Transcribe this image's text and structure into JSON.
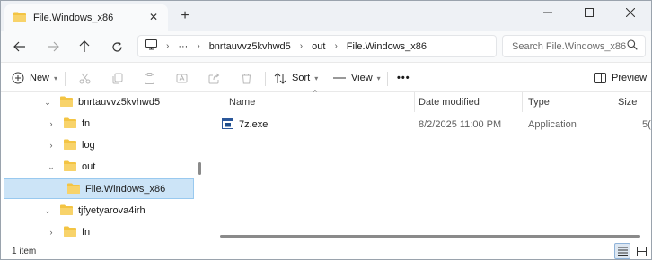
{
  "window": {
    "tab_title": "File.Windows_x86",
    "new_tab_symbol": "+",
    "close_tab_symbol": "✕"
  },
  "address": {
    "ellipsis": "···",
    "crumbs": [
      "bnrtauvvz5kvhwd5",
      "out",
      "File.Windows_x86"
    ],
    "search_placeholder": "Search File.Windows_x86"
  },
  "toolbar": {
    "new_label": "New",
    "sort_label": "Sort",
    "view_label": "View",
    "more_label": "•••",
    "preview_label": "Preview"
  },
  "nav_tree": [
    {
      "label": "bnrtauvvz5kvhwd5",
      "expanded": true,
      "selected": false
    },
    {
      "label": "fn",
      "expanded": false,
      "selected": false
    },
    {
      "label": "log",
      "expanded": false,
      "selected": false
    },
    {
      "label": "out",
      "expanded": true,
      "selected": false
    },
    {
      "label": "File.Windows_x86",
      "expanded": false,
      "selected": true
    },
    {
      "label": "tjfyetyarova4irh",
      "expanded": true,
      "selected": false
    },
    {
      "label": "fn",
      "expanded": false,
      "selected": false
    }
  ],
  "columns": {
    "name": "Name",
    "date_modified": "Date modified",
    "type": "Type",
    "size": "Size"
  },
  "files": [
    {
      "name": "7z.exe",
      "date_modified": "8/2/2025 11:00 PM",
      "type": "Application",
      "size": "5("
    }
  ],
  "status": {
    "item_count": "1 item"
  },
  "colors": {
    "folder": "#f3c443",
    "selection": "#cce4f7",
    "accent": "#0067c0"
  }
}
